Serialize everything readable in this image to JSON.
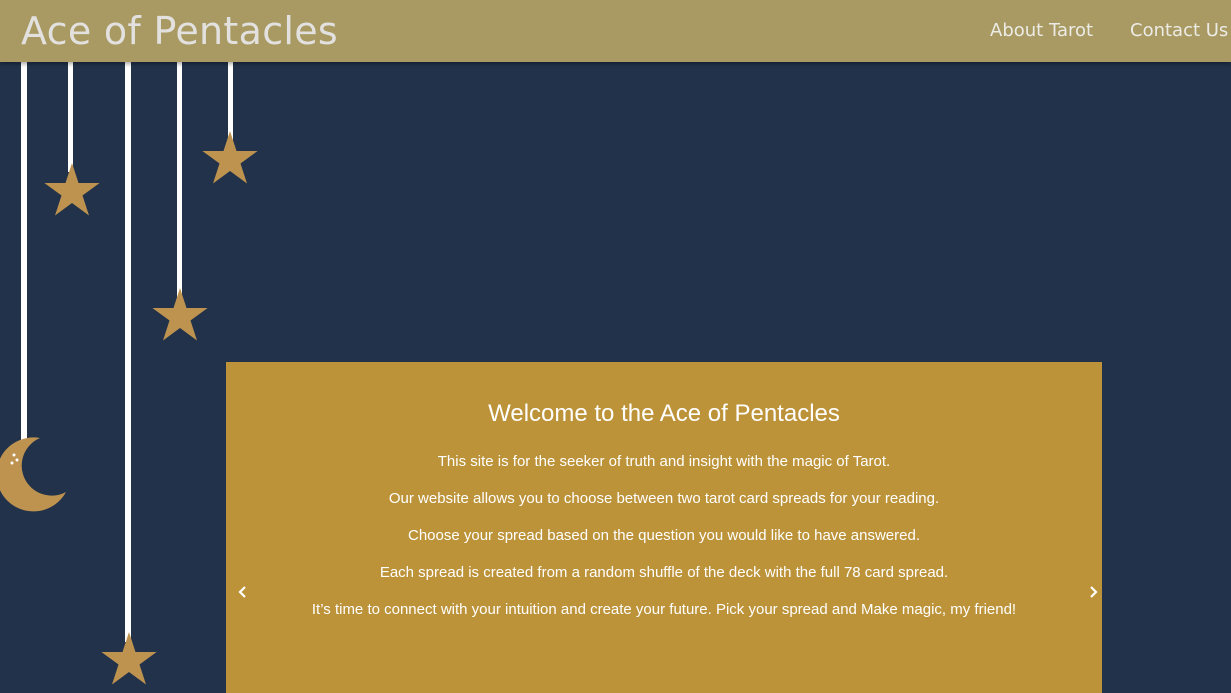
{
  "header": {
    "brand": "Ace of Pentacles",
    "nav": [
      {
        "label": "About Tarot"
      },
      {
        "label": "Contact Us"
      }
    ]
  },
  "colors": {
    "navbar": "#a89a62",
    "background": "#22324a",
    "panel": "#bd9339",
    "ornament": "#be9350"
  },
  "carousel": {
    "title": "Welcome to the Ace of Pentacles",
    "lines": [
      "This site is for the seeker of truth and insight with the magic of Tarot.",
      "Our website allows you to choose between two tarot card spreads for your reading.",
      "Choose your spread based on the question you would like to have answered.",
      "Each spread is created from a random shuffle of the deck with the full 78 card spread.",
      "It’s time to connect with your intuition and create your future. Pick your spread and Make magic, my friend!"
    ],
    "prev_icon": "chevron-left-icon",
    "next_icon": "chevron-right-icon"
  },
  "decorations": [
    "hanging-star-icon",
    "hanging-star-icon",
    "hanging-star-icon",
    "hanging-star-icon",
    "crescent-moon-icon"
  ]
}
